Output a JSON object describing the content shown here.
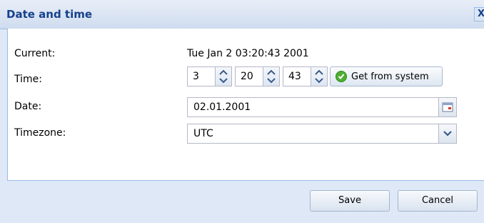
{
  "dialog": {
    "title": "Date and time",
    "close_label": "X"
  },
  "form": {
    "current_label": "Current:",
    "current_value": "Tue Jan 2 03:20:43 2001",
    "time_label": "Time:",
    "hours": "3",
    "minutes": "20",
    "seconds": "43",
    "get_from_system_label": "Get from system",
    "date_label": "Date:",
    "date_value": "02.01.2001",
    "timezone_label": "Timezone:",
    "timezone_value": "UTC"
  },
  "buttons": {
    "save_label": "Save",
    "cancel_label": "Cancel"
  },
  "colors": {
    "title_text": "#15428b",
    "frame_bg": "#dfe8f6",
    "border": "#99bbe8"
  }
}
